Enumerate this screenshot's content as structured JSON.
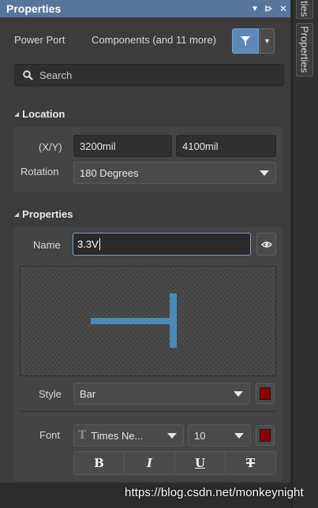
{
  "panel": {
    "title": "Properties",
    "controls": [
      "pin-dropdown",
      "pin",
      "close"
    ]
  },
  "dock": {
    "tab_top_label": "ties",
    "tab_label": "Properties"
  },
  "header": {
    "object_type": "Power Port",
    "filter_summary": "Components (and 11 more)"
  },
  "search": {
    "placeholder": "Search"
  },
  "location": {
    "section_title": "Location",
    "xy_label": "(X/Y)",
    "x_value": "3200mil",
    "y_value": "4100mil",
    "rotation_label": "Rotation",
    "rotation_value": "180 Degrees"
  },
  "properties": {
    "section_title": "Properties",
    "name_label": "Name",
    "name_value": "3.3V",
    "style_label": "Style",
    "style_value": "Bar",
    "style_color": "#8b0000",
    "font_label": "Font",
    "font_family": "Times Ne...",
    "font_size": "10",
    "font_color": "#8b0000",
    "format_buttons": [
      "B",
      "I",
      "U",
      "T"
    ]
  },
  "preview": {
    "symbol_color": "#4a8ab8"
  },
  "watermark": "https://blog.csdn.net/monkeynight",
  "colors": {
    "title_bar": "#58759c",
    "accent": "#5c88b8",
    "panel_bg": "#3c3c3c"
  }
}
